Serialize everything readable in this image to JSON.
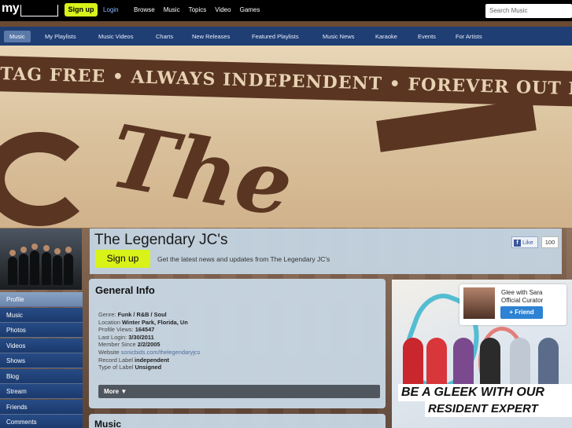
{
  "topbar": {
    "logo": "my",
    "signup_label": "Sign up",
    "login_label": "Login",
    "nav": [
      "Browse",
      "Music",
      "Topics",
      "Video",
      "Games"
    ],
    "search_placeholder": "Search Music"
  },
  "subnav": {
    "items": [
      "Music",
      "My Playlists",
      "Music Videos",
      "Charts",
      "New Releases",
      "Featured Playlists",
      "Music News",
      "Karaoke",
      "Events",
      "For Artists"
    ]
  },
  "banner": {
    "text": "TAG FREE • ALWAYS INDEPENDENT • FOREVER OUT F",
    "art_word": "The"
  },
  "profile": {
    "name": "The Legendary JC's",
    "signup_label": "Sign up",
    "tagline": "Get the latest news and updates from The Legendary JC's",
    "like_label": "Like",
    "like_count": "100"
  },
  "side_menu": [
    "Profile",
    "Music",
    "Photos",
    "Videos",
    "Shows",
    "Blog",
    "Stream",
    "Friends",
    "Comments"
  ],
  "general_info": {
    "title": "General Info",
    "genre_label": "Genre:",
    "genre_value": "Funk / R&B / Soul",
    "location_label": "Location",
    "location_value": "Winter Park, Florida, Un",
    "views_label": "Profile Views:",
    "views_value": "164547",
    "login_label": "Last Login:",
    "login_value": "3/30/2011",
    "member_label": "Member Since",
    "member_value": "2/2/2005",
    "website_label": "Website",
    "website_value": "sonicbids.com/thelegendaryjcs",
    "record_label_label": "Record Label",
    "record_label_value": "independent",
    "label_type_label": "Type of Label",
    "label_type_value": "Unsigned",
    "more_label": "More ▼"
  },
  "music_section": {
    "title": "Music"
  },
  "ad": {
    "friend_name_line1": "Glee with Sara",
    "friend_name_line2": "Official Curator",
    "friend_button": "+ Friend",
    "text_line1": "BE A GLEEK WITH OUR",
    "text_line2": "RESIDENT EXPERT"
  }
}
